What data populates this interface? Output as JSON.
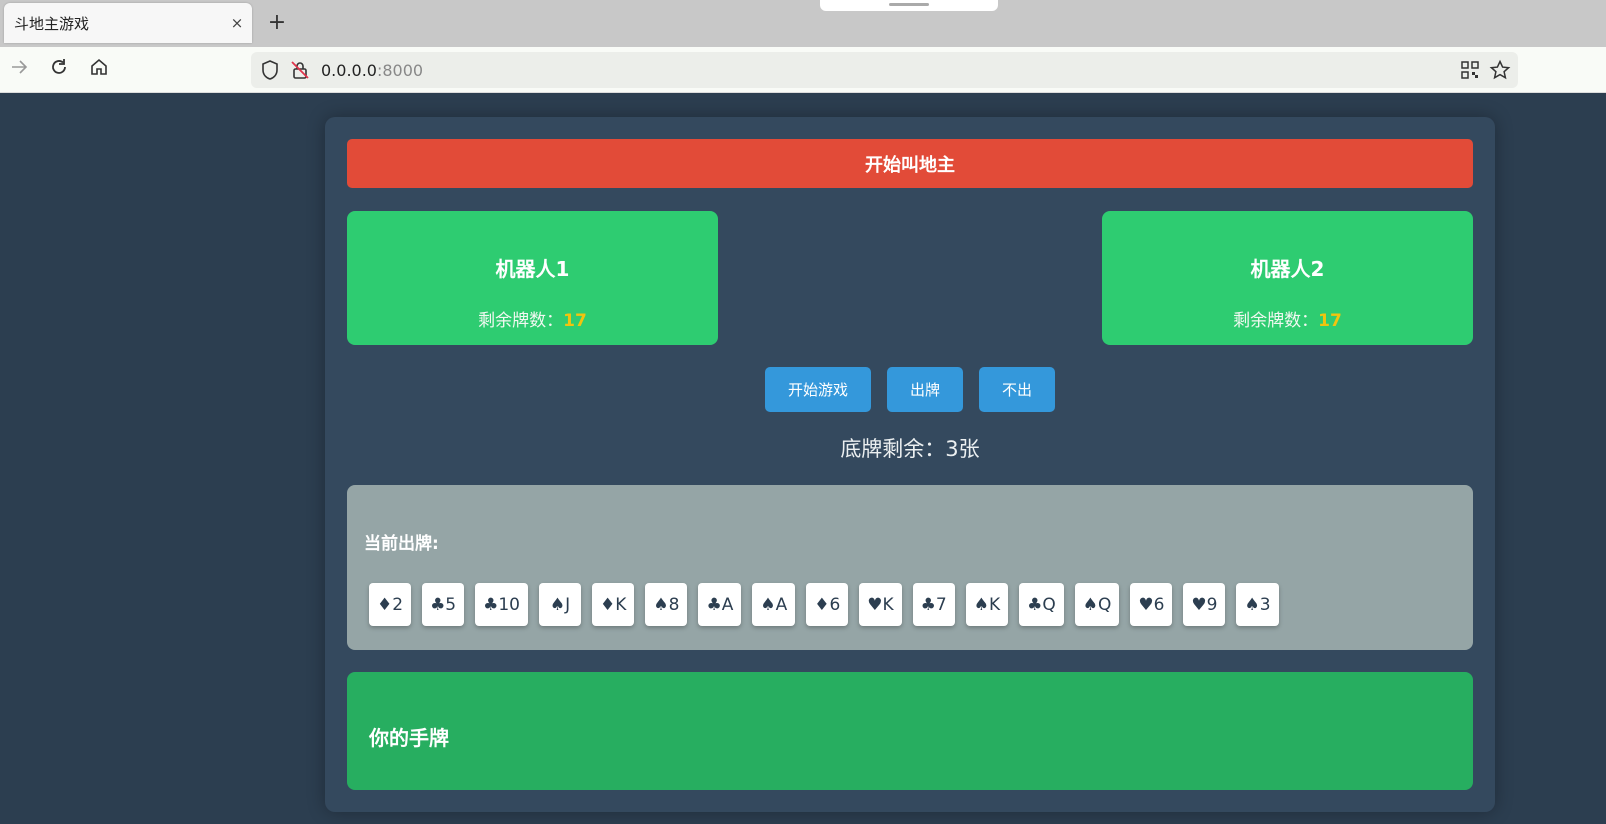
{
  "browser": {
    "tab_title": "斗地主游戏",
    "tab_close": "×",
    "new_tab": "+",
    "url_host": "0.0.0.0",
    "url_port": ":8000"
  },
  "game": {
    "banner": "开始叫地主",
    "bots": [
      {
        "name": "机器人1",
        "count_label": "剩余牌数：",
        "count": "17"
      },
      {
        "name": "机器人2",
        "count_label": "剩余牌数：",
        "count": "17"
      }
    ],
    "buttons": {
      "start": "开始游戏",
      "play": "出牌",
      "pass": "不出"
    },
    "bottom_cards": "底牌剩余：3张",
    "play_area_title": "当前出牌:",
    "played_cards": [
      "♦2",
      "♣5",
      "♣10",
      "♠J",
      "♦K",
      "♠8",
      "♣A",
      "♠A",
      "♦6",
      "♥K",
      "♣7",
      "♠K",
      "♣Q",
      "♠Q",
      "♥6",
      "♥9",
      "♠3"
    ],
    "hand_title": "你的手牌"
  },
  "colors": {
    "background": "#2c3e50",
    "container": "#34495e",
    "banner": "#e24b38",
    "bot_panel": "#2ecc71",
    "count_highlight": "#f1c40f",
    "button": "#3498db",
    "play_area": "#95a5a6",
    "hand_area": "#27ae60"
  }
}
